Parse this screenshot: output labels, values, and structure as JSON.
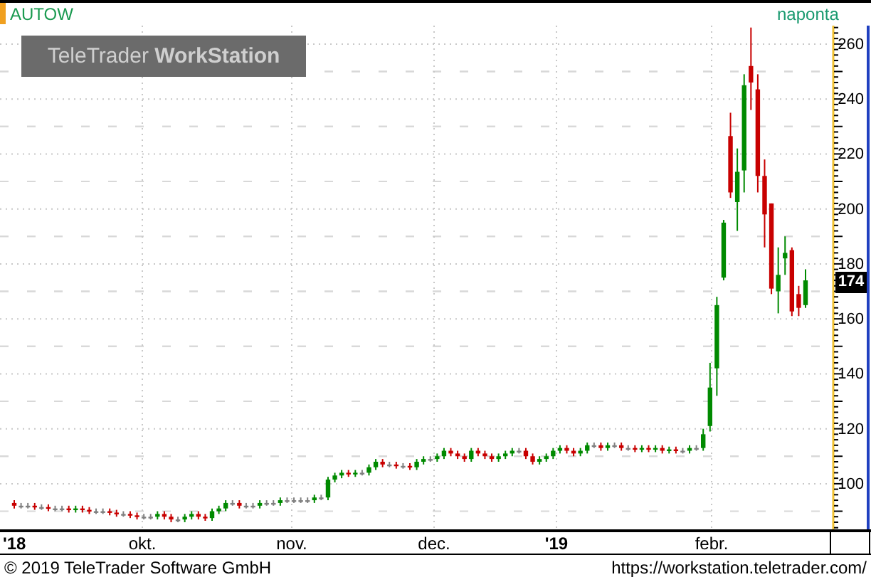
{
  "chart": {
    "symbol": "AUTOW",
    "interval": "naponta",
    "logo": "TeleTrader **WorkStation**",
    "last_price": "174",
    "date_axis": [
      {
        "label": "'18",
        "year": true
      },
      {
        "label": "okt.",
        "year": false
      },
      {
        "label": "nov.",
        "year": false
      },
      {
        "label": "dec.",
        "year": false
      },
      {
        "label": "'19",
        "year": true
      },
      {
        "label": "febr.",
        "year": false
      }
    ],
    "chart_data": {
      "type": "candlestick",
      "grid": true,
      "ylim": [
        83.4,
        266.7
      ],
      "yticks": [
        100,
        120,
        140,
        160,
        180,
        200,
        220,
        240,
        260
      ],
      "ohlc": [
        [
          93,
          94,
          91,
          92
        ],
        [
          92,
          93,
          91,
          92
        ],
        [
          92,
          93,
          91,
          92
        ],
        [
          92,
          93,
          90.5,
          91.5
        ],
        [
          91.5,
          92.5,
          90.5,
          91.5
        ],
        [
          91.5,
          92.5,
          90,
          91
        ],
        [
          91,
          92,
          90,
          91
        ],
        [
          91,
          92,
          90,
          91
        ],
        [
          91,
          92,
          89.5,
          90.5
        ],
        [
          90.5,
          92,
          89.5,
          91
        ],
        [
          91,
          92,
          89.5,
          90.5
        ],
        [
          90.5,
          91.5,
          89,
          90
        ],
        [
          90,
          91,
          89,
          90
        ],
        [
          90,
          91,
          89,
          90
        ],
        [
          90,
          91,
          88.5,
          89.5
        ],
        [
          89.5,
          90.5,
          88,
          89
        ],
        [
          89,
          90,
          88,
          89
        ],
        [
          89,
          90,
          87.5,
          88.5
        ],
        [
          88.5,
          89.5,
          87,
          88
        ],
        [
          88,
          89,
          87,
          88
        ],
        [
          88,
          89,
          87,
          88
        ],
        [
          88,
          90,
          87,
          89
        ],
        [
          89,
          90,
          87,
          88
        ],
        [
          88,
          89,
          86,
          87
        ],
        [
          87,
          88,
          86,
          87
        ],
        [
          87,
          89,
          86,
          88
        ],
        [
          88,
          90,
          87,
          89
        ],
        [
          89,
          90,
          87,
          88
        ],
        [
          88,
          89,
          86.5,
          87.5
        ],
        [
          87.5,
          91,
          86.5,
          90
        ],
        [
          90,
          92,
          89,
          91
        ],
        [
          91,
          94,
          90,
          93
        ],
        [
          93,
          94,
          92,
          93
        ],
        [
          93,
          94,
          91,
          92
        ],
        [
          92,
          93,
          91,
          92
        ],
        [
          92,
          93,
          91,
          92
        ],
        [
          92,
          94,
          91,
          93
        ],
        [
          93,
          94,
          92,
          93
        ],
        [
          93,
          94,
          92,
          93
        ],
        [
          93,
          95,
          92,
          94
        ],
        [
          94,
          95,
          93,
          94
        ],
        [
          94,
          95,
          93,
          94
        ],
        [
          94,
          95,
          93,
          94
        ],
        [
          94,
          95,
          93,
          94
        ],
        [
          94,
          96,
          93,
          95
        ],
        [
          95,
          96,
          94,
          95
        ],
        [
          95,
          102.5,
          94,
          101.5
        ],
        [
          101.5,
          104,
          100.5,
          103
        ],
        [
          103,
          105,
          102,
          104
        ],
        [
          104,
          105,
          102.5,
          103.5
        ],
        [
          103.5,
          105,
          102.5,
          104
        ],
        [
          104,
          105,
          103,
          104
        ],
        [
          104,
          107,
          103,
          106
        ],
        [
          106,
          109,
          105,
          108
        ],
        [
          108,
          109,
          106,
          107
        ],
        [
          107,
          108,
          106,
          107
        ],
        [
          107,
          108,
          105.5,
          106.5
        ],
        [
          106.5,
          107.5,
          105.5,
          106.5
        ],
        [
          106.5,
          107.5,
          105,
          106
        ],
        [
          106,
          109,
          105,
          108
        ],
        [
          108,
          110,
          107,
          109
        ],
        [
          109,
          110,
          108,
          109
        ],
        [
          109,
          111,
          108,
          110
        ],
        [
          110,
          113,
          109,
          112
        ],
        [
          112,
          113,
          110,
          111
        ],
        [
          111,
          112,
          109,
          110
        ],
        [
          110,
          111,
          108,
          109
        ],
        [
          109,
          113,
          108,
          112
        ],
        [
          112,
          113,
          110,
          111
        ],
        [
          111,
          112,
          109,
          110
        ],
        [
          110,
          111,
          108,
          109
        ],
        [
          109,
          111,
          108,
          110
        ],
        [
          110,
          112,
          109,
          111
        ],
        [
          111,
          113,
          110,
          112
        ],
        [
          112,
          113,
          111,
          112
        ],
        [
          112,
          113,
          109,
          110
        ],
        [
          110,
          111,
          107,
          108
        ],
        [
          108,
          110,
          107,
          109
        ],
        [
          109,
          111,
          108,
          110
        ],
        [
          110,
          113,
          109,
          112
        ],
        [
          112,
          114,
          111,
          113
        ],
        [
          113,
          114,
          111,
          112
        ],
        [
          112,
          113,
          110,
          111
        ],
        [
          111,
          113,
          110,
          112
        ],
        [
          112,
          115,
          111,
          114
        ],
        [
          114,
          115,
          113,
          114
        ],
        [
          114,
          115,
          112,
          113
        ],
        [
          113,
          115,
          112,
          114
        ],
        [
          114,
          115,
          113,
          114
        ],
        [
          114,
          115,
          112,
          113
        ],
        [
          113,
          114,
          112,
          113
        ],
        [
          113,
          114,
          111.5,
          112.5
        ],
        [
          112.5,
          114,
          111.5,
          113
        ],
        [
          113,
          114,
          111.5,
          112.5
        ],
        [
          112.5,
          114,
          111.5,
          113
        ],
        [
          113,
          114,
          111,
          112
        ],
        [
          112,
          113.5,
          111,
          112.5
        ],
        [
          112.5,
          113.5,
          111,
          112
        ],
        [
          112,
          113,
          111,
          112
        ],
        [
          112,
          114,
          111,
          113
        ],
        [
          113,
          114,
          112,
          113
        ],
        [
          113,
          120,
          112,
          118
        ],
        [
          121,
          144,
          119,
          135
        ],
        [
          142,
          168,
          132,
          165
        ],
        [
          175,
          196,
          174,
          195
        ],
        [
          226.5,
          235,
          204,
          206
        ],
        [
          202.5,
          222,
          192,
          213.5
        ],
        [
          214,
          249,
          206,
          245
        ],
        [
          252,
          266,
          236,
          246
        ],
        [
          243.5,
          249,
          206,
          212
        ],
        [
          212,
          218,
          186,
          198
        ],
        [
          202,
          202,
          169,
          171
        ],
        [
          170,
          186,
          162,
          176
        ],
        [
          182,
          190,
          176,
          184
        ],
        [
          185,
          186,
          161,
          162.7
        ],
        [
          169,
          172,
          161,
          164
        ],
        [
          165,
          178,
          164,
          174
        ]
      ]
    }
  },
  "footer": {
    "copyright": "© 2019 TeleTrader Software GmbH",
    "url": "https://workstation.teletrader.com/"
  }
}
